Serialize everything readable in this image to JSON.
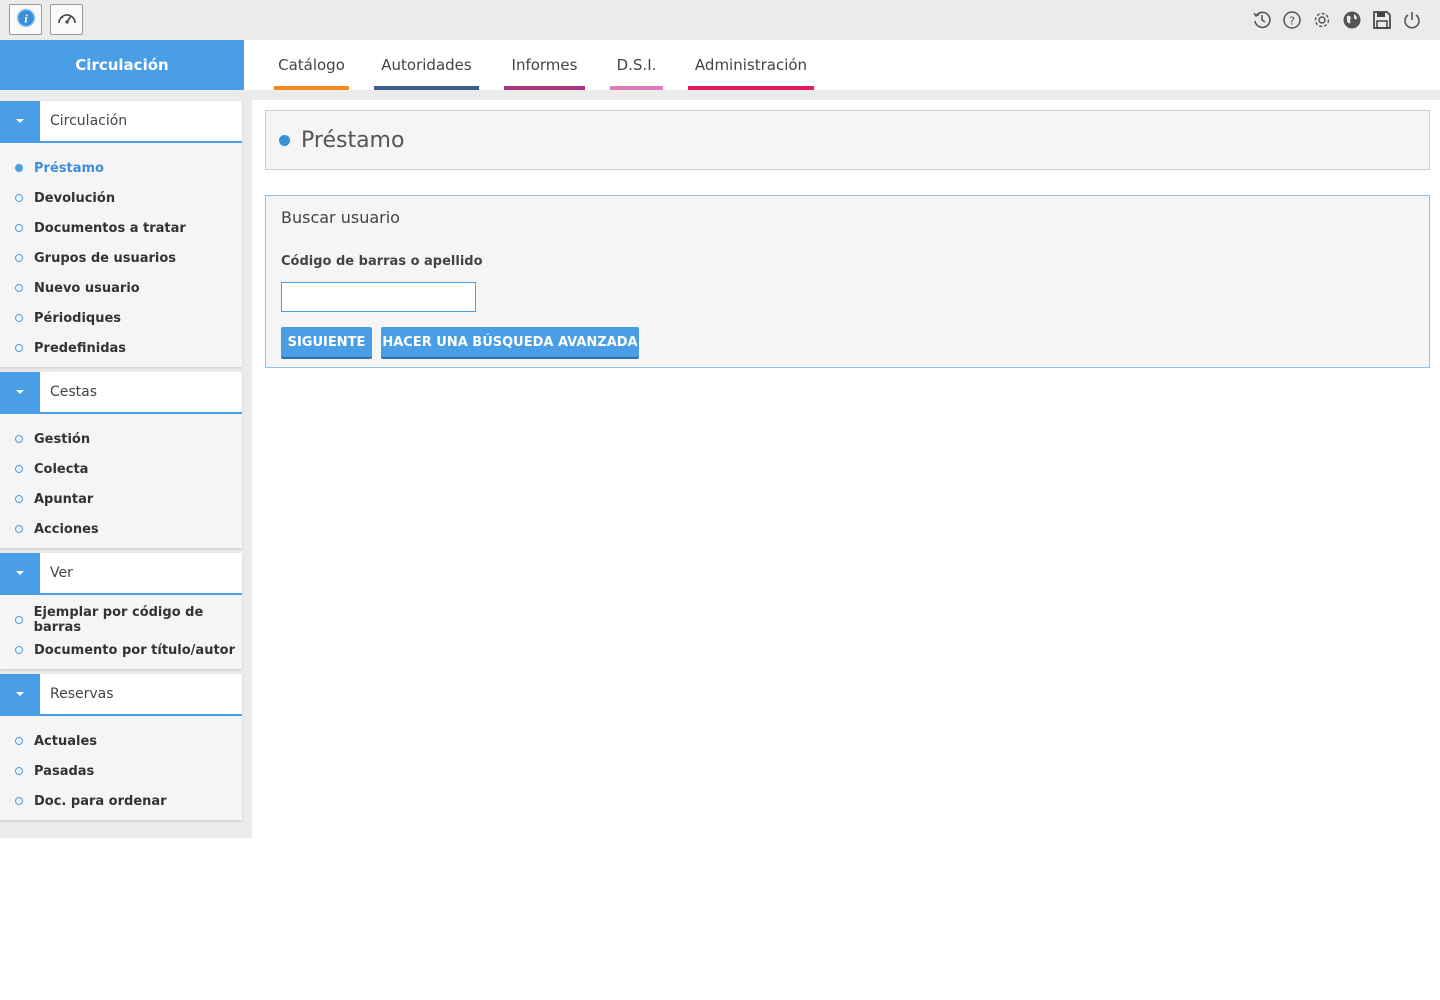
{
  "app": {
    "module": "Circulación",
    "accent_color": "#4a9ee6"
  },
  "toolbar": {
    "left_icons": [
      "info-icon",
      "dashboard-icon"
    ],
    "right_icons": [
      "history-icon",
      "help-icon",
      "settings-icon",
      "globe-icon",
      "save-icon",
      "power-icon"
    ]
  },
  "nav": {
    "tabs": [
      {
        "label": "Catálogo",
        "color": "#f08c1a"
      },
      {
        "label": "Autoridades",
        "color": "#3d5f8f"
      },
      {
        "label": "Informes",
        "color": "#a8357a"
      },
      {
        "label": "D.S.I.",
        "color": "#e07ab8"
      },
      {
        "label": "Administración",
        "color": "#e6185a"
      }
    ]
  },
  "sidebar": {
    "sections": [
      {
        "title": "Circulación",
        "items": [
          "Préstamo",
          "Devolución",
          "Documentos a tratar",
          "Grupos de usuarios",
          "Nuevo usuario",
          "Périodiques",
          "Predefinidas"
        ]
      },
      {
        "title": "Cestas",
        "items": [
          "Gestión",
          "Colecta",
          "Apuntar",
          "Acciones"
        ]
      },
      {
        "title": "Ver",
        "items": [
          "Ejemplar por código de barras",
          "Documento por título/autor"
        ]
      },
      {
        "title": "Reservas",
        "items": [
          "Actuales",
          "Pasadas",
          "Doc. para ordenar"
        ]
      }
    ],
    "active_item": "Préstamo"
  },
  "main": {
    "page_title": "Préstamo",
    "form": {
      "title": "Buscar usuario",
      "field_label": "Código de barras o apellido",
      "field_value": "",
      "next_button": "SIGUIENTE",
      "advanced_button": "HACER UNA BÚSQUEDA AVANZADA"
    }
  }
}
